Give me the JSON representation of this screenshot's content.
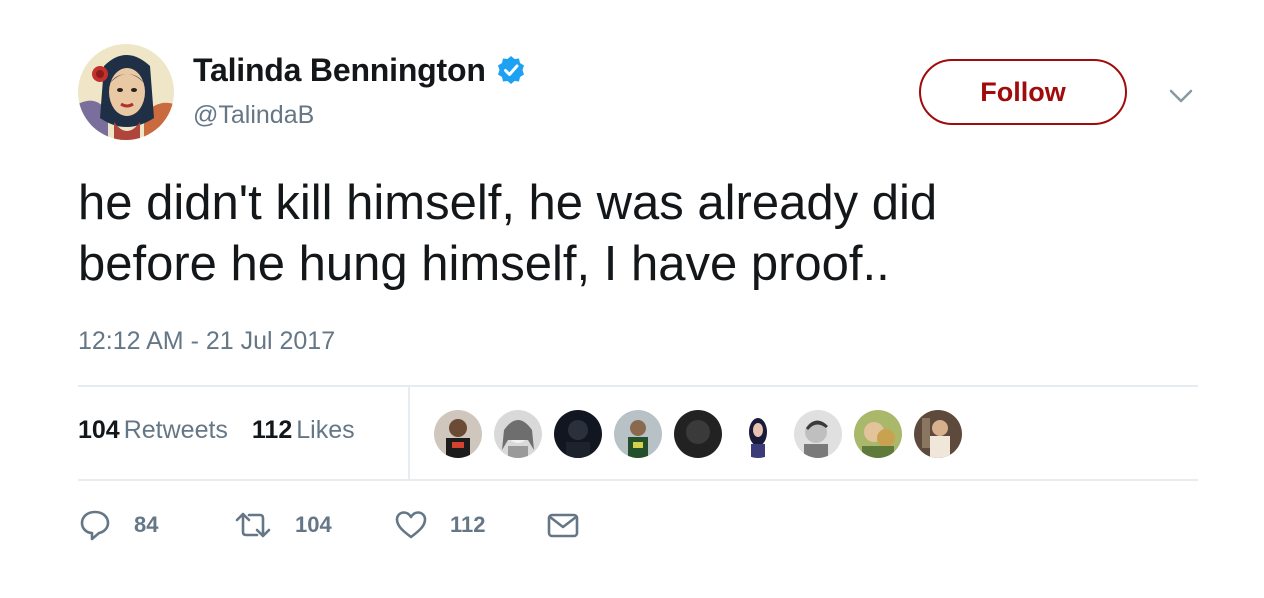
{
  "user": {
    "display_name": "Talinda Bennington",
    "handle": "@TalindaB",
    "verified_icon": "verified-badge-icon",
    "avatar": "profile-photo"
  },
  "follow_button": {
    "label": "Follow"
  },
  "menu_icon": "chevron-down-icon",
  "tweet": {
    "lines": [
      "he didn't kill himself, he was already did",
      "before he hung himself, I have proof.."
    ],
    "timestamp": "12:12 AM - 21 Jul 2017"
  },
  "stats": {
    "retweets_count": "104",
    "retweets_label": "Retweets",
    "likes_count": "112",
    "likes_label": "Likes"
  },
  "likers": [
    {
      "name": "liker-avatar-1"
    },
    {
      "name": "liker-avatar-2"
    },
    {
      "name": "liker-avatar-3"
    },
    {
      "name": "liker-avatar-4"
    },
    {
      "name": "liker-avatar-5"
    },
    {
      "name": "liker-avatar-6"
    },
    {
      "name": "liker-avatar-7"
    },
    {
      "name": "liker-avatar-8"
    },
    {
      "name": "liker-avatar-9"
    }
  ],
  "actions": {
    "reply_count": "84",
    "retweet_count": "104",
    "like_count": "112"
  },
  "colors": {
    "follow_accent": "#a00b0b",
    "verified_blue": "#1da1f2",
    "secondary_text": "#657786",
    "primary_text": "#14171a",
    "divider": "#e6ecf0"
  }
}
